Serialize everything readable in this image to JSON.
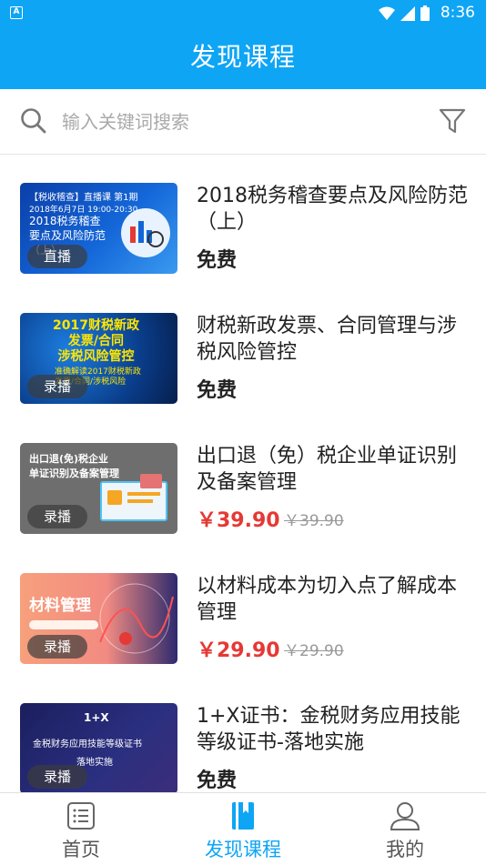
{
  "status_bar": {
    "time": "8:36",
    "app_badge": "A"
  },
  "header": {
    "title": "发现课程"
  },
  "search": {
    "placeholder": "输入关键词搜索"
  },
  "courses": [
    {
      "thumb_text": "【税收稽查】直播课 第1期\n2018年6月7日\n2018税务稽查\n要点及风险防范\n（上）",
      "badge": "直播",
      "title": "2018税务稽查要点及风险防范（上）",
      "price": "免费",
      "original_price": ""
    },
    {
      "thumb_text": "2017财税新政\n发票/合同\n涉税风险管控",
      "badge": "录播",
      "title": "财税新政发票、合同管理与涉税风险管控",
      "price": "免费",
      "original_price": ""
    },
    {
      "thumb_text": "出口退(免)税企业\n单证识别及备案管理",
      "badge": "录播",
      "title": "出口退（免）税企业单证识别及备案管理",
      "price": "￥39.90",
      "original_price": "￥39.90"
    },
    {
      "thumb_text": "材料管理",
      "badge": "录播",
      "title": "以材料成本为切入点了解成本管理",
      "price": "￥29.90",
      "original_price": "￥29.90"
    },
    {
      "thumb_text": "1+X\n金税财务应用技能等级证书\n落地实施",
      "badge": "录播",
      "title": "1+X证书：金税财务应用技能等级证书-落地实施",
      "price": "免费",
      "original_price": ""
    }
  ],
  "bottom_nav": [
    {
      "label": "首页",
      "icon": "home-list-icon"
    },
    {
      "label": "发现课程",
      "icon": "book-icon"
    },
    {
      "label": "我的",
      "icon": "person-icon"
    }
  ],
  "colors": {
    "accent": "#0ea5f5",
    "price_red": "#e53935"
  }
}
